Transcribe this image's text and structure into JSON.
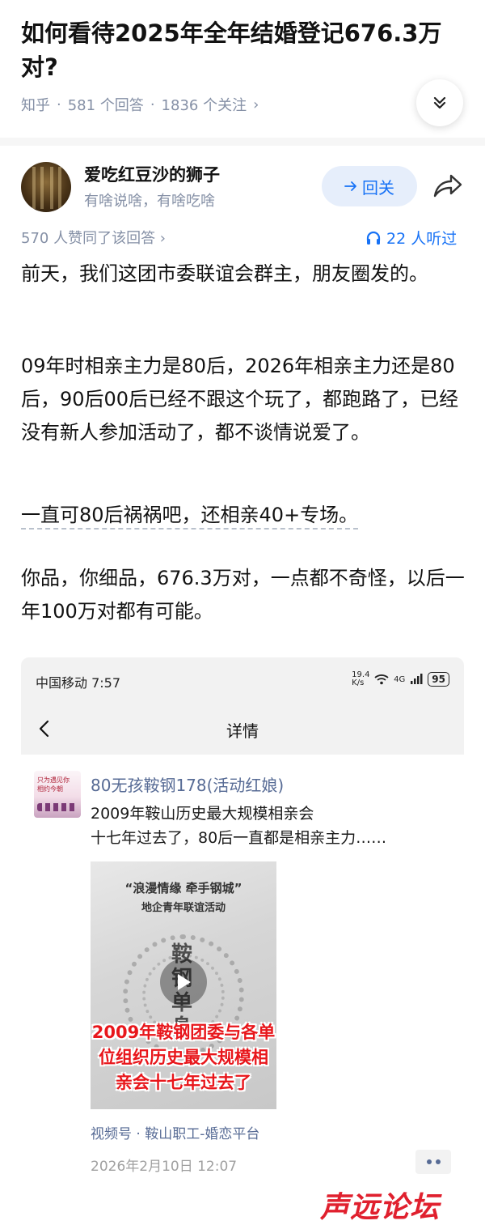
{
  "question": {
    "title": "如何看待2025年全年结婚登记676.3万对?",
    "source": "知乎",
    "answers": "581 个回答",
    "follows": "1836 个关注",
    "meta_arrow": "›"
  },
  "author": {
    "name": "爱吃红豆沙的狮子",
    "bio": "有啥说啥，有啥吃啥",
    "follow_label": "回关"
  },
  "answer_stats": {
    "votes": "570 人赞同了该回答 ›",
    "listened": "22 人听过"
  },
  "answer": {
    "p1": "前天，我们这团市委联谊会群主，朋友圈发的。",
    "p2": "09年时相亲主力是80后，2026年相亲主力还是80后，90后00后已经不跟这个玩了，都跑路了，已经没有新人参加活动了，都不谈情说爱了。",
    "p3": "一直可80后祸祸吧，还相亲40+专场。",
    "p4": "你品，你细品，676.3万对，一点都不奇怪，以后一年100万对都有可能。"
  },
  "screenshot": {
    "status": {
      "carrier_time": "中国移动 7:57",
      "net_speed": "19.4 K/s",
      "signal": "4G",
      "battery": "95"
    },
    "nav_title": "详情",
    "post": {
      "avatar_text": "只为遇见你 相约今朝",
      "name": "80无孩鞍钢178(活动红娘)",
      "line1": "2009年鞍山历史最大规模相亲会",
      "line2": "十七年过去了，80后一直都是相亲主力……",
      "video": {
        "top1": "“浪漫情缘  牵手钢城”",
        "top2": "地企青年联谊活动",
        "vertical": "鞍钢单身",
        "caption": "2009年鞍钢团委与各单位组织历史最大规模相亲会十七年过去了"
      },
      "source": "视频号 · 鞍山职工-婚恋平台",
      "time": "2026年2月10日 12:07"
    }
  },
  "watermark": "声远论坛",
  "colors": {
    "accent_blue": "#1772f6",
    "link_blue": "#576b95",
    "gray": "#8590a6",
    "red": "#e0202e"
  }
}
